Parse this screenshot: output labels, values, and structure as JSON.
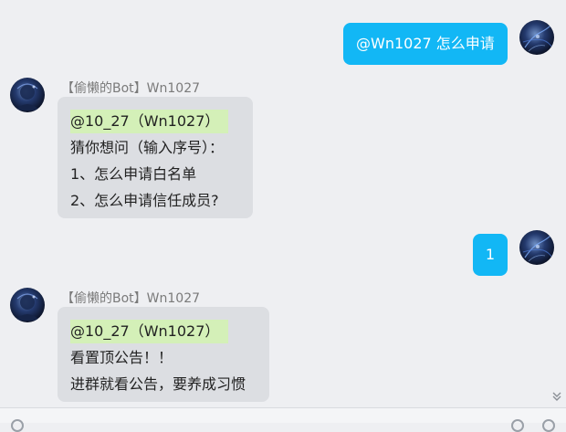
{
  "messages": {
    "out1": {
      "text": "@Wn1027 怎么申请"
    },
    "in1": {
      "sender": "【偷懒的Bot】Wn1027",
      "mention": "@10_27（Wn1027）",
      "lines": [
        "猜你想问（输入序号）：",
        "1、怎么申请白名单",
        "2、怎么申请信任成员?"
      ]
    },
    "out2": {
      "text": "1"
    },
    "in2": {
      "sender": "【偷懒的Bot】Wn1027",
      "mention": "@10_27（Wn1027）",
      "lines": [
        "看置顶公告！！",
        "进群就看公告，要养成习惯"
      ]
    }
  },
  "colors": {
    "outgoing_bubble": "#12b7f5",
    "incoming_bubble": "#dcdee2",
    "mention_highlight": "#d4f0b8",
    "background": "#eeeff2"
  },
  "icons": {
    "scroll_down": "double-chevron-down-icon"
  }
}
